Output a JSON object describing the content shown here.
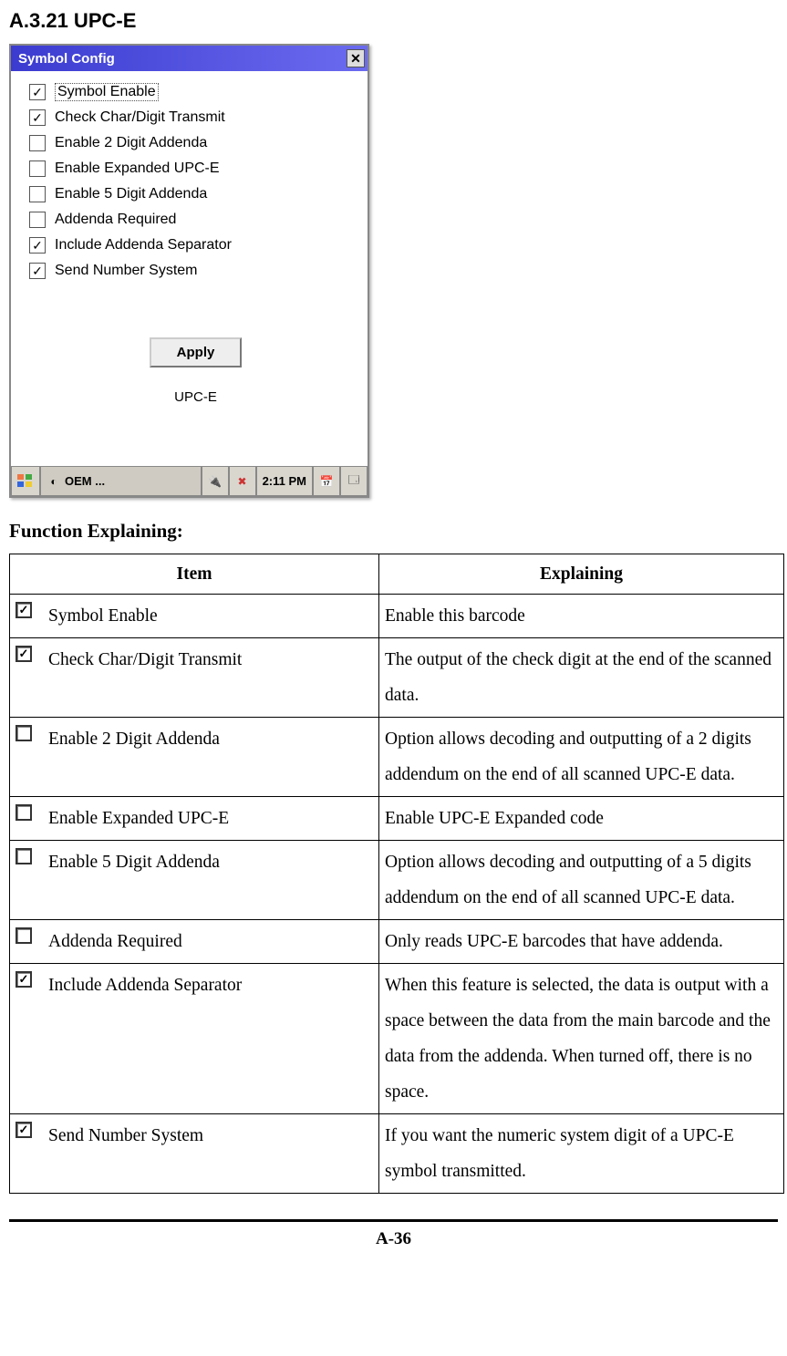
{
  "heading": "A.3.21 UPC-E",
  "dialog": {
    "title": "Symbol Config",
    "options": [
      {
        "label": "Symbol Enable",
        "checked": true,
        "focus": true
      },
      {
        "label": "Check Char/Digit Transmit",
        "checked": true,
        "focus": false
      },
      {
        "label": "Enable 2 Digit Addenda",
        "checked": false,
        "focus": false
      },
      {
        "label": "Enable Expanded UPC-E",
        "checked": false,
        "focus": false
      },
      {
        "label": "Enable 5 Digit Addenda",
        "checked": false,
        "focus": false
      },
      {
        "label": "Addenda Required",
        "checked": false,
        "focus": false
      },
      {
        "label": "Include Addenda Separator",
        "checked": true,
        "focus": false
      },
      {
        "label": "Send Number System",
        "checked": true,
        "focus": false
      }
    ],
    "apply_label": "Apply",
    "caption": "UPC-E"
  },
  "taskbar": {
    "oem_label": "OEM ...",
    "time": "2:11 PM"
  },
  "function_heading": "Function Explaining:",
  "table": {
    "headers": {
      "item": "Item",
      "explaining": "Explaining"
    },
    "rows": [
      {
        "checked": true,
        "item": "Symbol Enable",
        "explaining": "Enable this barcode"
      },
      {
        "checked": true,
        "item": "Check Char/Digit Transmit",
        "explaining": "The output of the check digit at the end of the scanned data."
      },
      {
        "checked": false,
        "item": "Enable 2 Digit Addenda",
        "explaining": "Option allows decoding and outputting of a 2 digits addendum on the end of all scanned UPC-E data."
      },
      {
        "checked": false,
        "item": "Enable Expanded UPC-E",
        "explaining": "Enable UPC-E Expanded code"
      },
      {
        "checked": false,
        "item": "Enable 5 Digit Addenda",
        "explaining": "Option allows decoding and outputting of a 5 digits addendum on the end of all scanned UPC-E data."
      },
      {
        "checked": false,
        "item": "Addenda Required",
        "explaining": "Only reads UPC-E barcodes that have addenda."
      },
      {
        "checked": true,
        "item": "Include Addenda Separator",
        "explaining": "When this feature is selected, the data is output with a space between the data from the main barcode and the data from the addenda. When turned off, there is no space."
      },
      {
        "checked": true,
        "item": "Send Number System",
        "explaining": "If you want the numeric system digit of a UPC-E symbol transmitted."
      }
    ]
  },
  "page_number": "A-36"
}
